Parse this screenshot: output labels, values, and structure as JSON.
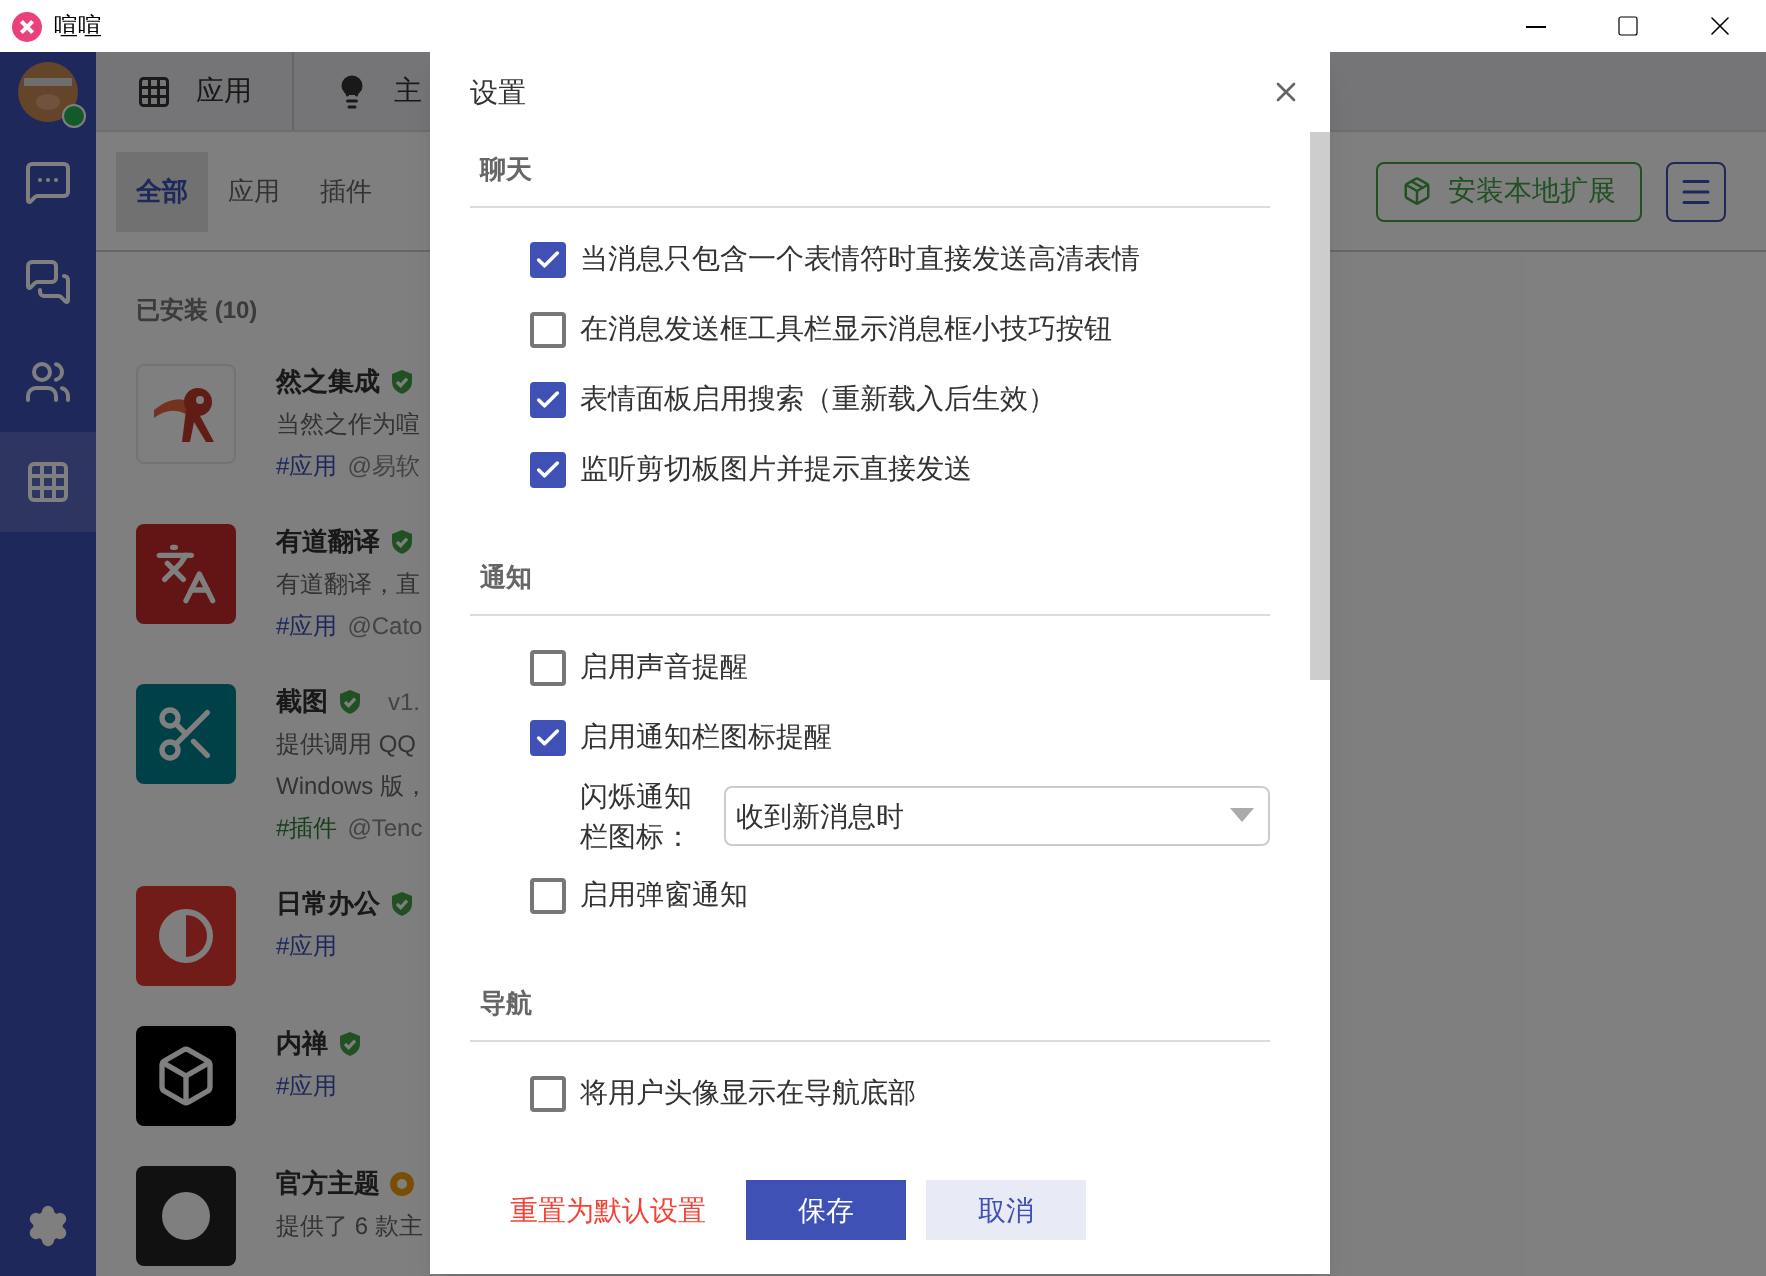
{
  "window": {
    "title": "喧喧"
  },
  "user": {
    "online": true
  },
  "sidebar": {
    "items": [
      {
        "kind": "chat",
        "selected": false
      },
      {
        "kind": "messages",
        "selected": false
      },
      {
        "kind": "contacts",
        "selected": false
      },
      {
        "kind": "apps",
        "selected": true
      }
    ]
  },
  "top_nav": [
    {
      "kind": "apps",
      "label": "应用"
    },
    {
      "kind": "theme",
      "label": "主"
    }
  ],
  "tabs": [
    {
      "label": "全部",
      "selected": true
    },
    {
      "label": "应用",
      "selected": false
    },
    {
      "label": "插件",
      "selected": false
    }
  ],
  "install_button": "安装本地扩展",
  "installed_label": "已安装 (10)",
  "apps": [
    {
      "name": "然之集成",
      "kind": "verified",
      "lines": [
        "当然之作为喧"
      ],
      "tag": {
        "kind": "app",
        "text": "#应用"
      },
      "author": "@易软"
    },
    {
      "name": "有道翻译",
      "kind": "verified",
      "lines": [
        "有道翻译，直"
      ],
      "tag": {
        "kind": "app",
        "text": "#应用"
      },
      "author": "@Cato"
    },
    {
      "name": "截图",
      "kind": "verified",
      "version": "v1.",
      "lines": [
        "提供调用 QQ",
        "Windows 版，"
      ],
      "tag": {
        "kind": "plugin",
        "text": "#插件"
      },
      "author": "@Tenc"
    },
    {
      "name": "日常办公",
      "kind": "verified",
      "tag": {
        "kind": "app",
        "text": "#应用"
      }
    },
    {
      "name": "内禅",
      "kind": "verified",
      "tag": {
        "kind": "app",
        "text": "#应用"
      }
    },
    {
      "name": "官方主题",
      "kind": "official",
      "lines": [
        "提供了 6 款主"
      ]
    }
  ],
  "dialog": {
    "title": "设置",
    "sections": [
      {
        "title": "聊天",
        "items": [
          {
            "kind": "checkbox",
            "label": "当消息只包含一个表情符时直接发送高清表情",
            "checked": true
          },
          {
            "kind": "checkbox",
            "label": "在消息发送框工具栏显示消息框小技巧按钮",
            "checked": false
          },
          {
            "kind": "checkbox",
            "label": "表情面板启用搜索（重新载入后生效）",
            "checked": true
          },
          {
            "kind": "checkbox",
            "label": "监听剪切板图片并提示直接发送",
            "checked": true
          }
        ]
      },
      {
        "title": "通知",
        "items": [
          {
            "kind": "checkbox",
            "label": "启用声音提醒",
            "checked": false
          },
          {
            "kind": "checkbox",
            "label": "启用通知栏图标提醒",
            "checked": true
          },
          {
            "kind": "select",
            "label": "闪烁通知栏图标：",
            "value": "收到新消息时"
          },
          {
            "kind": "checkbox",
            "label": "启用弹窗通知",
            "checked": false
          }
        ]
      },
      {
        "title": "导航",
        "items": [
          {
            "kind": "checkbox",
            "label": "将用户头像显示在导航底部",
            "checked": false
          }
        ]
      }
    ],
    "reset": "重置为默认设置",
    "save": "保存",
    "cancel": "取消"
  }
}
